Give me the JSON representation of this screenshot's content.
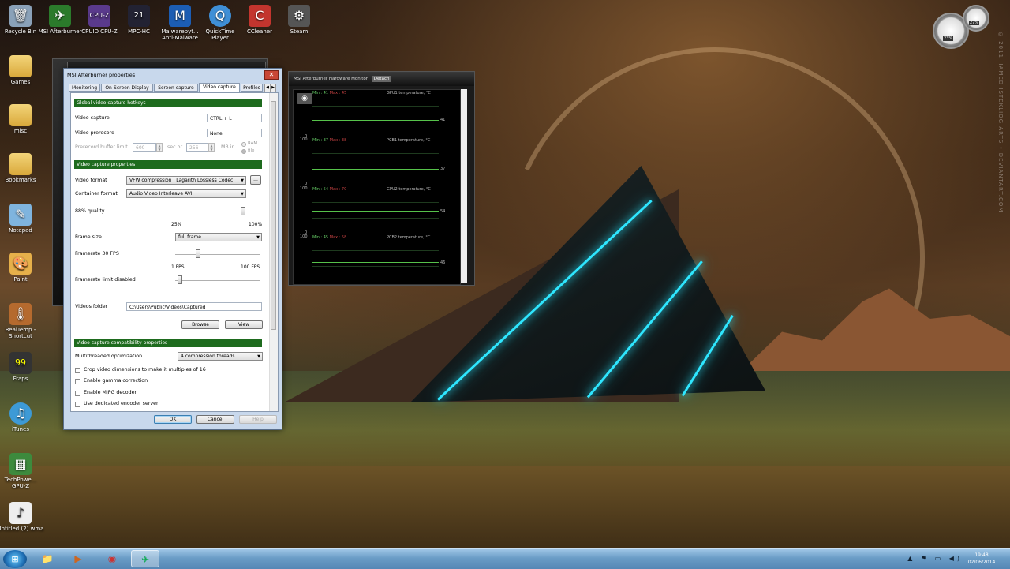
{
  "desktop": {
    "watermark": "© 2011 HAMED ISTEKLIOG ARTS • DEVIANTART.COM",
    "icons": [
      {
        "label": "Recycle Bin",
        "icon": "recycle-bin-icon"
      },
      {
        "label": "MSI Afterburner",
        "icon": "msi-afterburner-icon"
      },
      {
        "label": "CPUID CPU-Z",
        "icon": "cpuz-icon"
      },
      {
        "label": "MPC-HC",
        "icon": "mpc-hc-icon"
      },
      {
        "label": "Malwarebyt... Anti-Malware",
        "icon": "malwarebytes-icon"
      },
      {
        "label": "QuickTime Player",
        "icon": "quicktime-icon"
      },
      {
        "label": "CCleaner",
        "icon": "ccleaner-icon"
      },
      {
        "label": "Steam",
        "icon": "steam-icon"
      },
      {
        "label": "Games",
        "icon": "folder-icon"
      },
      {
        "label": "misc",
        "icon": "folder-icon"
      },
      {
        "label": "Bookmarks",
        "icon": "folder-icon"
      },
      {
        "label": "Notepad",
        "icon": "notepad-icon"
      },
      {
        "label": "Paint",
        "icon": "paint-icon"
      },
      {
        "label": "RealTemp - Shortcut",
        "icon": "realtemp-icon"
      },
      {
        "label": "Fraps",
        "icon": "fraps-icon"
      },
      {
        "label": "iTunes",
        "icon": "itunes-icon"
      },
      {
        "label": "TechPowe... GPU-Z",
        "icon": "gpuz-icon"
      },
      {
        "label": "Untitled (2).wma",
        "icon": "wma-file-icon"
      }
    ]
  },
  "gadget": {
    "cpu_label": "23%",
    "mem_label": "27%"
  },
  "hwmon": {
    "title": "MSI Afterburner Hardware Monitor",
    "detach_label": "Detach",
    "graphs": [
      {
        "name": "GPU1 temperature, °C",
        "min_label": "Min : 41",
        "max_label": "Max : 45",
        "current": "41",
        "top": "100",
        "bottom": "0",
        "level": 41
      },
      {
        "name": "PCB1 temperature, °C",
        "min_label": "Min : 37",
        "max_label": "Max : 38",
        "current": "37",
        "top": "100",
        "bottom": "0",
        "level": 37
      },
      {
        "name": "GPU2 temperature, °C",
        "min_label": "Min : 54",
        "max_label": "Max : 70",
        "current": "54",
        "top": "100",
        "bottom": "0",
        "level": 54
      },
      {
        "name": "PCB2 temperature, °C",
        "min_label": "Min : 45",
        "max_label": "Max : 58",
        "current": "46",
        "top": "100",
        "bottom": "0",
        "level": 46
      }
    ]
  },
  "dialog": {
    "title": "MSI Afterburner properties",
    "close": "✕",
    "tabs": [
      "Monitoring",
      "On-Screen Display",
      "Screen capture",
      "Video capture",
      "Profiles"
    ],
    "active_tab": "Video capture",
    "sections": {
      "hotkeys": "Global video capture hotkeys",
      "properties": "Video capture properties",
      "compat": "Video capture compatibility properties"
    },
    "video_capture": {
      "label": "Video capture",
      "value": "CTRL + L"
    },
    "video_prerecord": {
      "label": "Video prerecord",
      "value": "None"
    },
    "prerecord_limit": {
      "label": "Prerecord buffer limit",
      "sec_value": "600",
      "sec_label": "sec or",
      "mb_value": "256",
      "mb_label": "MB in",
      "ram": "RAM",
      "file": "file"
    },
    "video_format": {
      "label": "Video format",
      "value": "VFW compression : Lagarith Lossless Codec",
      "more": "..."
    },
    "container_format": {
      "label": "Container format",
      "value": "Audio Video Interleave AVI"
    },
    "quality": {
      "label": "88% quality",
      "min": "25%",
      "max": "100%",
      "value": 88
    },
    "frame_size": {
      "label": "Frame size",
      "value": "full frame"
    },
    "framerate": {
      "label": "Framerate 30 FPS",
      "min": "1 FPS",
      "max": "100 FPS",
      "value": 30
    },
    "framerate_limit": {
      "label": "Framerate limit disabled",
      "value": 0
    },
    "videos_folder": {
      "label": "Videos folder",
      "value": "C:\\Users\\Public\\Videos\\Captured",
      "browse": "Browse",
      "view": "View"
    },
    "multithreaded": {
      "label": "Multithreaded optimization",
      "value": "4 compression threads"
    },
    "checkboxes": [
      "Crop video dimensions to make it multiples of 16",
      "Enable gamma correction",
      "Enable MJPG decoder",
      "Use dedicated encoder server"
    ],
    "buttons": {
      "ok": "OK",
      "cancel": "Cancel",
      "help": "Help"
    }
  },
  "taskbar": {
    "start": "⊞",
    "items": [
      {
        "icon": "explorer-icon",
        "glyph": "📁"
      },
      {
        "icon": "media-player-icon",
        "glyph": "▶"
      },
      {
        "icon": "chrome-icon",
        "glyph": "◉"
      },
      {
        "icon": "msi-afterburner-icon",
        "glyph": "✈"
      }
    ],
    "tray": "▲ ⚑ ▭ ◀)",
    "time": "19:48",
    "date": "02/06/2014"
  }
}
